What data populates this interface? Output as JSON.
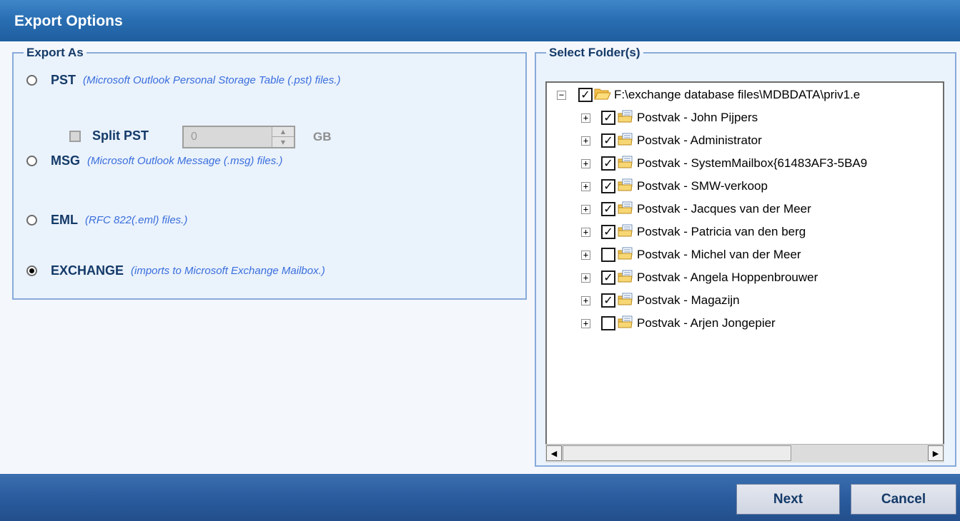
{
  "window": {
    "title": "Export Options"
  },
  "export_as": {
    "legend": "Export As",
    "options": [
      {
        "name": "PST",
        "desc": "(Microsoft Outlook Personal Storage Table (.pst) files.)",
        "selected": false
      },
      {
        "name": "MSG",
        "desc": "(Microsoft Outlook Message (.msg) files.)",
        "selected": false
      },
      {
        "name": "EML",
        "desc": "(RFC 822(.eml) files.)",
        "selected": false
      },
      {
        "name": "EXCHANGE",
        "desc": "(imports to Microsoft Exchange Mailbox.)",
        "selected": true
      }
    ],
    "split": {
      "label": "Split PST",
      "value": "0",
      "unit": "GB",
      "enabled": false,
      "checked": false
    }
  },
  "select_folder": {
    "legend": "Select Folder(s)",
    "root": {
      "label": "F:\\exchange database files\\MDBDATA\\priv1.e",
      "checked": true,
      "expanded": true
    },
    "items": [
      {
        "label": "Postvak - John Pijpers",
        "checked": true
      },
      {
        "label": "Postvak - Administrator",
        "checked": true
      },
      {
        "label": "Postvak - SystemMailbox{61483AF3-5BA9",
        "checked": true
      },
      {
        "label": "Postvak - SMW-verkoop",
        "checked": true
      },
      {
        "label": "Postvak - Jacques van der Meer",
        "checked": true
      },
      {
        "label": "Postvak - Patricia van den berg",
        "checked": true
      },
      {
        "label": "Postvak - Michel van der Meer",
        "checked": false
      },
      {
        "label": "Postvak - Angela Hoppenbrouwer",
        "checked": true
      },
      {
        "label": "Postvak - Magazijn",
        "checked": true
      },
      {
        "label": "Postvak - Arjen Jongepier",
        "checked": false
      }
    ]
  },
  "buttons": {
    "next": "Next",
    "cancel": "Cancel"
  },
  "icons": {
    "folder_open": "folder-open-icon",
    "mailbox": "mailbox-icon",
    "expand": "plus-icon",
    "collapse": "minus-icon"
  },
  "colors": {
    "accent": "#2a6fb3",
    "legend_text": "#143a68",
    "desc_text": "#3a6fdc"
  }
}
